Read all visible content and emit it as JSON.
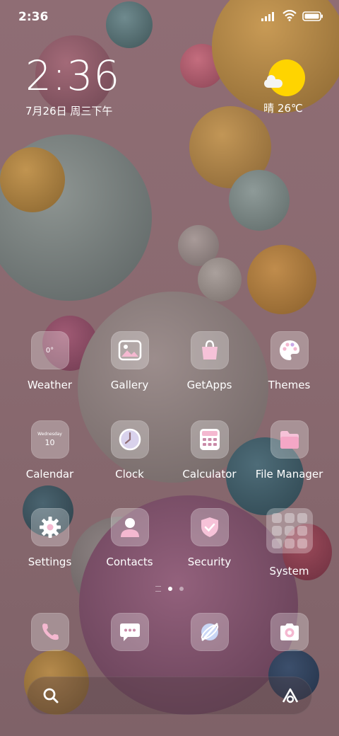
{
  "status_bar": {
    "time": "2:36"
  },
  "clock_widget": {
    "time": "2:36",
    "date": "7月26日 周三下午"
  },
  "weather_widget": {
    "text": "晴 26℃"
  },
  "apps": [
    {
      "label": "Weather",
      "icon": "weather-icon",
      "tile_text": "0°"
    },
    {
      "label": "Gallery",
      "icon": "gallery-icon"
    },
    {
      "label": "GetApps",
      "icon": "shopping-bag-icon"
    },
    {
      "label": "Themes",
      "icon": "palette-icon"
    },
    {
      "label": "Calendar",
      "icon": "calendar-icon",
      "tile_text": "Wednesday",
      "tile_day": "10"
    },
    {
      "label": "Clock",
      "icon": "clock-icon"
    },
    {
      "label": "Calculator",
      "icon": "calculator-icon"
    },
    {
      "label": "File Manager",
      "icon": "folder-icon"
    },
    {
      "label": "Settings",
      "icon": "gear-icon"
    },
    {
      "label": "Contacts",
      "icon": "person-icon"
    },
    {
      "label": "Security",
      "icon": "shield-icon"
    },
    {
      "label": "System",
      "icon": "folder-grid-icon"
    }
  ],
  "page_indicator": {
    "pages": 2,
    "active": 1
  },
  "dock": [
    {
      "icon": "phone-icon"
    },
    {
      "icon": "message-icon"
    },
    {
      "icon": "browser-icon"
    },
    {
      "icon": "camera-icon"
    }
  ],
  "colors": {
    "accent_pink": "#f4b8d0",
    "accent_blue": "#c9d6f5",
    "sun": "#ffd400"
  }
}
